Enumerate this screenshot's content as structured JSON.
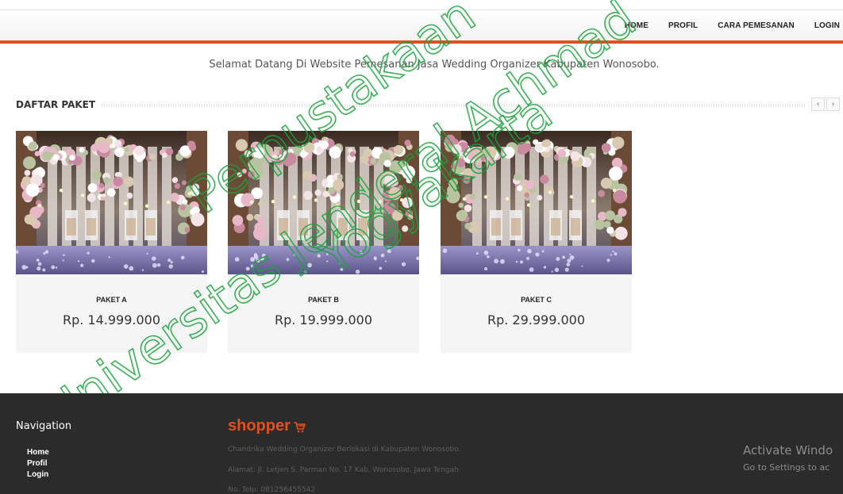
{
  "header": {
    "nav": [
      "HOME",
      "PROFIL",
      "CARA PEMESANAN",
      "LOGIN"
    ]
  },
  "welcome_text": "Selamat Datang Di Website Pemesanan Jasa Wedding Organizer Kabupaten Wonosobo.",
  "section": {
    "title": "DAFTAR PAKET",
    "prev_icon": "‹",
    "next_icon": "›"
  },
  "packages": [
    {
      "name": "PAKET A",
      "price": "Rp. 14.999.000"
    },
    {
      "name": "PAKET B",
      "price": "Rp. 19.999.000"
    },
    {
      "name": "PAKET C",
      "price": "Rp. 29.999.000"
    }
  ],
  "watermark": {
    "line1": "Perpustakaan",
    "line2": "Universitas Jenderal Achmad",
    "line3": "Yogyakarta"
  },
  "footer": {
    "nav_title": "Navigation",
    "links": [
      "Home",
      "Profil",
      "Login"
    ],
    "brand": "shopper",
    "description": "Chandrika Wedding Organizer Berlokasi di Kabupaten Wonosobo.",
    "address": "Alamat: Jl. Letjen S. Parman No. 17 Kab. Wonosobo, Jawa Tengah",
    "phone": "No. Telp: 081256455542"
  },
  "os_overlay": {
    "title": "Activate Windo",
    "subtitle": "Go to Settings to ac"
  },
  "colors": {
    "accent": "#e2501e",
    "footer_bg": "#2b2b2b",
    "card_bg": "#f5f5f5"
  }
}
